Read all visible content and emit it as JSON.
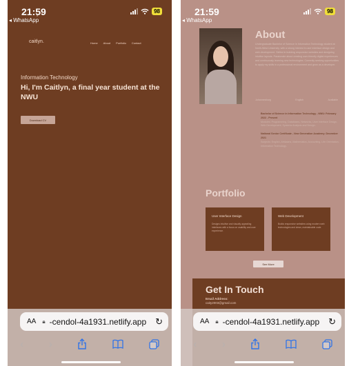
{
  "status": {
    "time": "21:59",
    "back_app": "◂ WhatsApp",
    "battery": "98"
  },
  "left": {
    "logo": "caitlyn.",
    "logo_mark": "*",
    "nav_links": [
      "Home",
      "About",
      "Portfolio",
      "Contact"
    ],
    "eyebrow": "Information Technology",
    "headline": "Hi, I'm Caitlyn, a final year student at the NWU",
    "cv_button": "Download CV"
  },
  "right": {
    "about": {
      "title": "About",
      "body": "Undergraduate Bachelor of Science in Information Technology student at North-West University, with a strong interest in user interface design and web development. Skilled in building responsive websites and designing intuitive layouts. Passionate about creating user-friendly digital experiences and continuously learning new technologies. Currently seeking opportunities to apply my skills in a professional environment and grow as a developer.",
      "meta": [
        "Johannesburg",
        "English",
        "Available"
      ]
    },
    "education": [
      {
        "title": "Bachelor of Science in Information Technology - NWU: February 2022 - Present",
        "detail": "Modules: Programming, Databases, Networks, User Interface Design, Web Development, Systems Analysis and Design."
      },
      {
        "title": "National Senior Certificate - New Generation Academy: December 2021",
        "detail": "Subjects: English, Afrikaans, Mathematics, Accounting, Life Orientation, Information Technology."
      }
    ],
    "portfolio": {
      "title": "Portfolio",
      "cards": [
        {
          "title": "User Interface Design",
          "text": "Designs intuitive and visually appealing interfaces with a focus on usability and user experience."
        },
        {
          "title": "Web Development",
          "text": "Builds responsive websites using modern web technologies and clean, maintainable code."
        }
      ],
      "see_more": "See More"
    },
    "contact": {
      "title": "Get In Touch",
      "email_label": "Email Address:",
      "email": "caity2003@gmail.com"
    }
  },
  "browser": {
    "aa": "AA",
    "url": "-cendol-4a1931.netlify.app"
  }
}
